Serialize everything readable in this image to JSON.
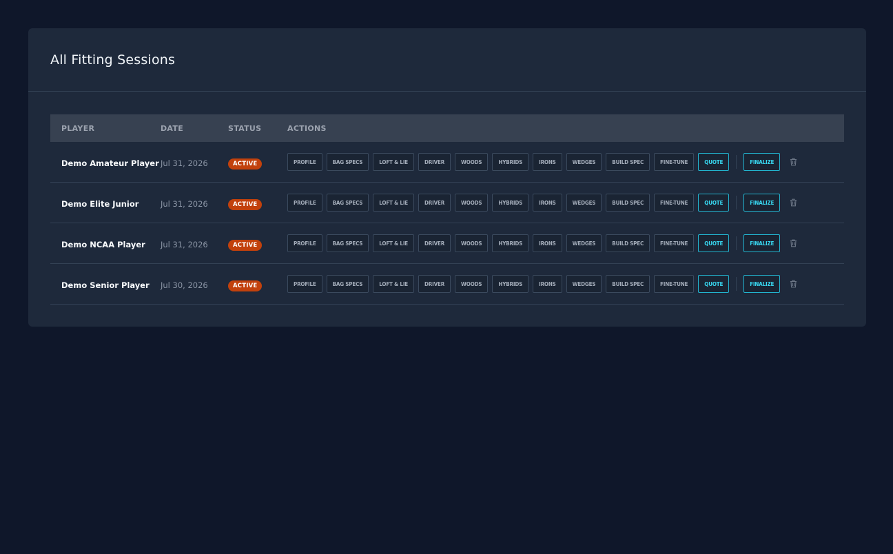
{
  "page": {
    "title": "All Fitting Sessions"
  },
  "table": {
    "headers": {
      "player": "PLAYER",
      "date": "DATE",
      "status": "STATUS",
      "actions": "ACTIONS"
    },
    "action_labels": [
      "PROFILE",
      "BAG SPECS",
      "LOFT & LIE",
      "DRIVER",
      "WOODS",
      "HYBRIDS",
      "IRONS",
      "WEDGES",
      "BUILD SPEC",
      "FINE-TUNE",
      "QUOTE"
    ],
    "finalize_label": "FINALIZE",
    "rows": [
      {
        "player": "Demo Amateur Player",
        "date": "Jul 31, 2026",
        "status": "ACTIVE"
      },
      {
        "player": "Demo Elite Junior",
        "date": "Jul 31, 2026",
        "status": "ACTIVE"
      },
      {
        "player": "Demo NCAA Player",
        "date": "Jul 31, 2026",
        "status": "ACTIVE"
      },
      {
        "player": "Demo Senior Player",
        "date": "Jul 30, 2026",
        "status": "ACTIVE"
      }
    ]
  },
  "colors": {
    "background": "#0f172a",
    "card": "#1e293b",
    "accent": "#38d7f0",
    "status_active": "#c2410c"
  },
  "icons": {
    "delete": "trash-icon"
  }
}
